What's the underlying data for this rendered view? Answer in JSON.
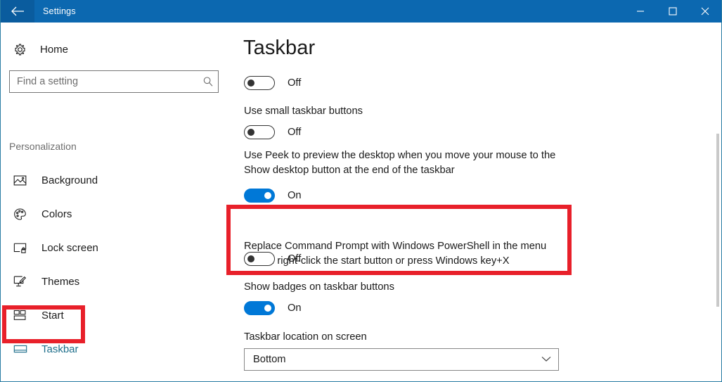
{
  "window": {
    "title": "Settings",
    "back_icon": "back-arrow-icon",
    "minimize_label": "–",
    "maximize_label": "☐",
    "close_label": "✕",
    "titlebar_color": "#0c68b0"
  },
  "sidebar": {
    "home": {
      "label": "Home",
      "icon": "gear-icon"
    },
    "search": {
      "value": "",
      "placeholder": "Find a setting",
      "icon": "search-icon"
    },
    "section_label": "Personalization",
    "items": [
      {
        "label": "Background",
        "icon": "picture-icon",
        "selected": false
      },
      {
        "label": "Colors",
        "icon": "palette-icon",
        "selected": false
      },
      {
        "label": "Lock screen",
        "icon": "lock-screen-icon",
        "selected": false
      },
      {
        "label": "Themes",
        "icon": "themes-brush-icon",
        "selected": false
      },
      {
        "label": "Start",
        "icon": "start-tiles-icon",
        "selected": false
      },
      {
        "label": "Taskbar",
        "icon": "taskbar-icon",
        "selected": true
      }
    ]
  },
  "main": {
    "title": "Taskbar",
    "settings": [
      {
        "description": "",
        "state": "Off",
        "on": false
      },
      {
        "description": "Use small taskbar buttons",
        "state": "Off",
        "on": false
      },
      {
        "description": "Use Peek to preview the desktop when you move your mouse to the Show desktop button at the end of the taskbar",
        "state": "On",
        "on": true
      },
      {
        "description": "Replace Command Prompt with Windows PowerShell in the menu when I right-click the start button or press Windows key+X",
        "state": "Off",
        "on": false
      },
      {
        "description": "Show badges on taskbar buttons",
        "state": "On",
        "on": true
      }
    ],
    "location_setting": {
      "label": "Taskbar location on screen",
      "value": "Bottom",
      "chevron_icon": "chevron-down-icon"
    }
  },
  "annotations": {
    "highlight_color": "#e8202a",
    "boxes": [
      {
        "name": "taskbar-nav-highlight"
      },
      {
        "name": "powershell-setting-highlight"
      }
    ]
  }
}
